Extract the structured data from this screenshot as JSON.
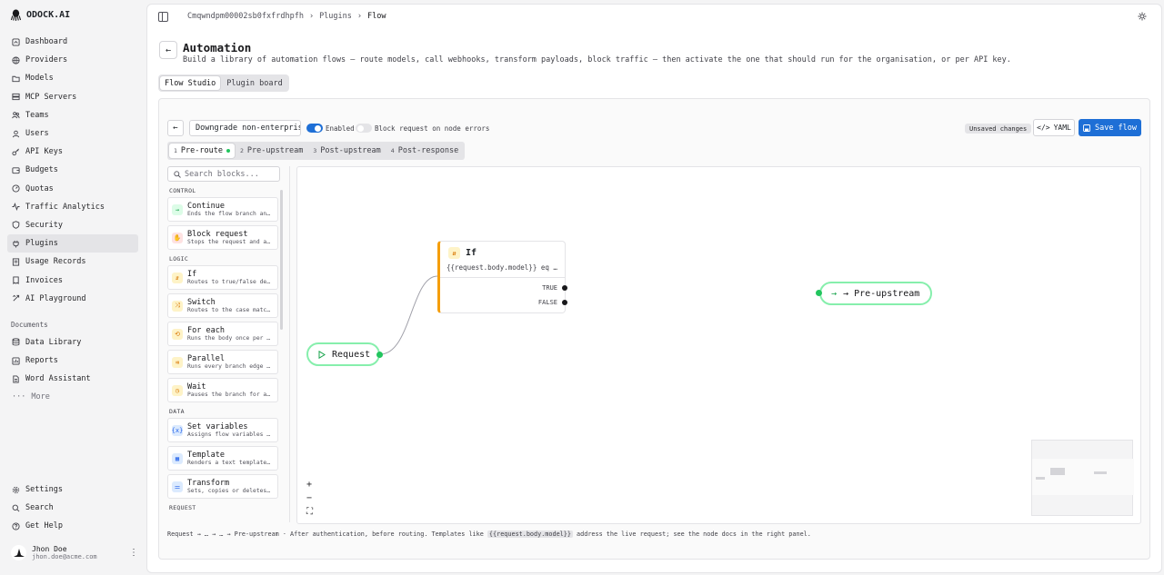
{
  "brand": {
    "name": "ODOCK.AI"
  },
  "sidebar": {
    "items": [
      {
        "label": "Dashboard",
        "icon": "dashboard-icon"
      },
      {
        "label": "Providers",
        "icon": "globe-icon"
      },
      {
        "label": "Models",
        "icon": "folder-icon"
      },
      {
        "label": "MCP Servers",
        "icon": "server-icon"
      },
      {
        "label": "Teams",
        "icon": "team-icon"
      },
      {
        "label": "Users",
        "icon": "user-icon"
      },
      {
        "label": "API Keys",
        "icon": "key-icon"
      },
      {
        "label": "Budgets",
        "icon": "wallet-icon"
      },
      {
        "label": "Quotas",
        "icon": "gauge-icon"
      },
      {
        "label": "Traffic Analytics",
        "icon": "activity-icon"
      },
      {
        "label": "Security",
        "icon": "shield-icon"
      },
      {
        "label": "Plugins",
        "icon": "plug-icon",
        "active": true
      },
      {
        "label": "Usage Records",
        "icon": "records-icon"
      },
      {
        "label": "Invoices",
        "icon": "invoice-icon"
      },
      {
        "label": "AI Playground",
        "icon": "playground-icon"
      }
    ],
    "documents_title": "Documents",
    "documents": [
      {
        "label": "Data Library",
        "icon": "database-icon"
      },
      {
        "label": "Reports",
        "icon": "report-icon"
      },
      {
        "label": "Word Assistant",
        "icon": "document-icon"
      }
    ],
    "more_label": "More",
    "bottom": [
      {
        "label": "Settings",
        "icon": "gear-icon"
      },
      {
        "label": "Search",
        "icon": "search-icon"
      },
      {
        "label": "Get Help",
        "icon": "help-icon"
      }
    ],
    "user": {
      "name": "Jhon Doe",
      "email": "jhon.doe@acme.com"
    }
  },
  "breadcrumb": [
    "Cmqwndpm00002sb0fxfrdhpfh",
    "Plugins",
    "Flow"
  ],
  "page": {
    "title": "Automation",
    "subtitle": "Build a library of automation flows — route models, call webhooks, transform payloads, block traffic — then activate the one that should run for the organisation, or per API key."
  },
  "tabs": [
    "Flow Studio",
    "Plugin board"
  ],
  "toolbar": {
    "flow_name": "Downgrade non-enterprise",
    "enabled_label": "Enabled",
    "block_label": "Block request on node errors",
    "unsaved": "Unsaved changes",
    "yaml": "YAML",
    "save": "Save flow"
  },
  "stages": [
    {
      "n": "1",
      "label": "Pre-route",
      "active": true
    },
    {
      "n": "2",
      "label": "Pre-upstream"
    },
    {
      "n": "3",
      "label": "Post-upstream"
    },
    {
      "n": "4",
      "label": "Post-response"
    }
  ],
  "palette": {
    "search_placeholder": "Search blocks...",
    "groups": {
      "control": "CONTROL",
      "logic": "LOGIC",
      "data": "DATA",
      "request": "REQUEST"
    },
    "control": [
      {
        "title": "Continue",
        "desc": "Ends the flow branch and continues",
        "color": "green",
        "glyph": "→"
      },
      {
        "title": "Block request",
        "desc": "Stops the request and answers",
        "color": "red",
        "glyph": "✋"
      }
    ],
    "logic": [
      {
        "title": "If",
        "desc": "Routes to true/false depending",
        "color": "amber",
        "glyph": "⇵"
      },
      {
        "title": "Switch",
        "desc": "Routes to the case matching",
        "color": "amber",
        "glyph": "⤨"
      },
      {
        "title": "For each",
        "desc": "Runs the body once per item",
        "color": "amber",
        "glyph": "⟲"
      },
      {
        "title": "Parallel",
        "desc": "Runs every branch edge concurrently",
        "color": "amber",
        "glyph": "⇉"
      },
      {
        "title": "Wait",
        "desc": "Pauses the branch for a delay",
        "color": "amber",
        "glyph": "◷"
      }
    ],
    "data": [
      {
        "title": "Set variables",
        "desc": "Assigns flow variables used later",
        "color": "blue",
        "glyph": "{x}"
      },
      {
        "title": "Template",
        "desc": "Renders a text template into",
        "color": "blue",
        "glyph": "▦"
      },
      {
        "title": "Transform",
        "desc": "Sets, copies or deletes fields",
        "color": "blue",
        "glyph": "⚌"
      }
    ]
  },
  "canvas": {
    "request_label": "Request",
    "if_title": "If",
    "if_condition": "{{request.body.model}} eq …",
    "true_label": "TRUE",
    "false_label": "FALSE",
    "next_label": "→ Pre-upstream"
  },
  "footer": {
    "prefix": "Request → … → … → Pre-upstream · After authentication, before routing. Templates like ",
    "code": "{{request.body.model}}",
    "suffix": " address the live request; see the node docs in the right panel."
  }
}
